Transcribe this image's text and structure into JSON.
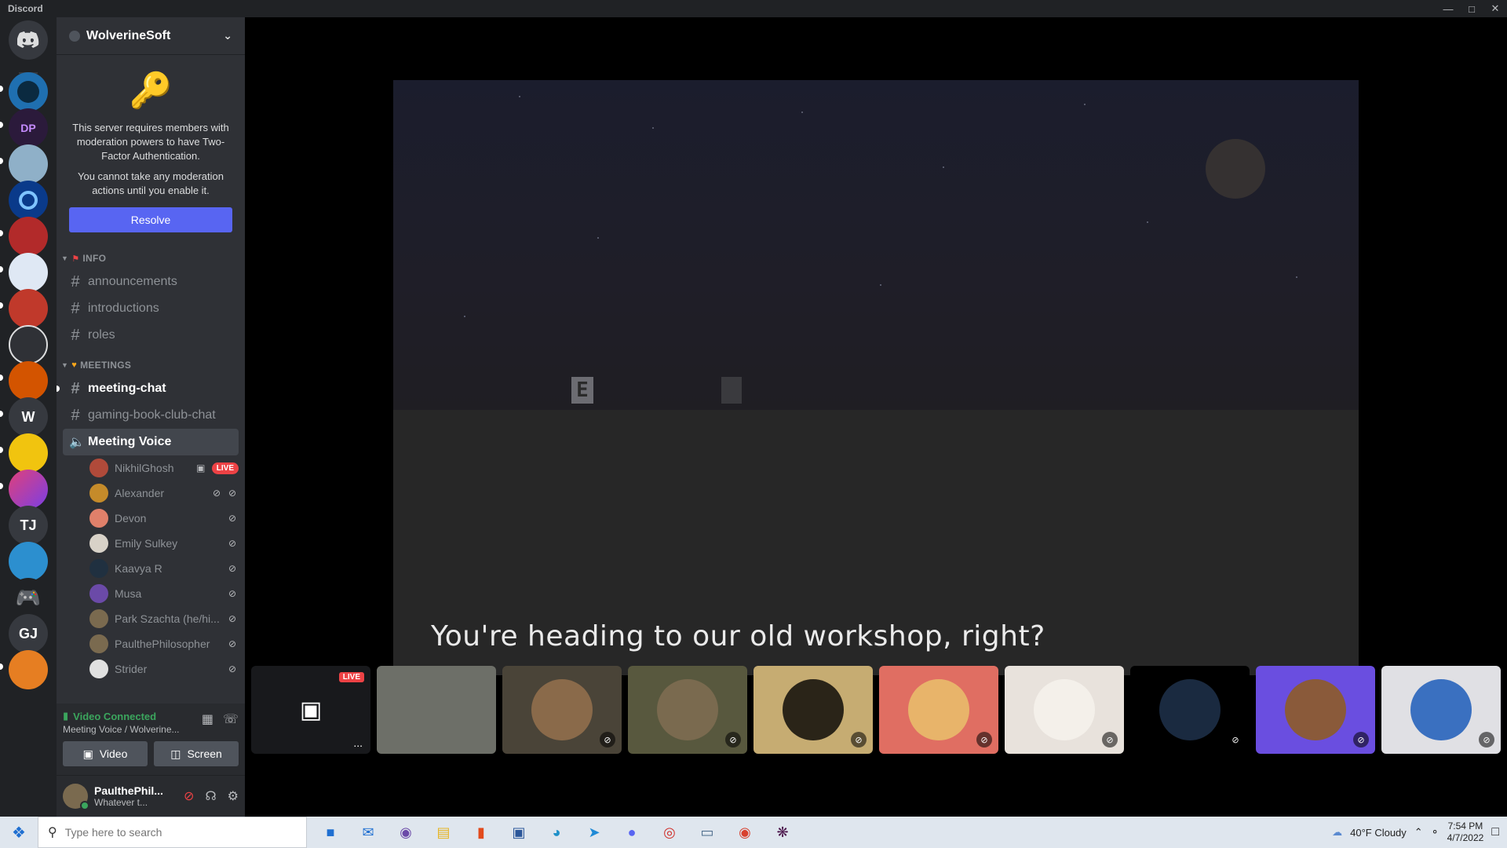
{
  "window": {
    "title": "Discord"
  },
  "server": {
    "name": "WolverineSoft",
    "twofa_message_1": "This server requires members with moderation powers to have Two-Factor Authentication.",
    "twofa_message_2": "You cannot take any moderation actions until you enable it.",
    "resolve_label": "Resolve"
  },
  "rail": {
    "home": "Discord",
    "letters": [
      "W",
      "TJ",
      "GJ"
    ]
  },
  "categories": {
    "info": "INFO",
    "meetings": "MEETINGS"
  },
  "channels": {
    "announcements": "announcements",
    "introductions": "introductions",
    "roles": "roles",
    "meeting_chat": "meeting-chat",
    "gaming_book_club": "gaming-book-club-chat",
    "meeting_voice": "Meeting Voice"
  },
  "voice_users": [
    {
      "name": "NikhilGhosh",
      "live": "LIVE",
      "color": "#b04a3a"
    },
    {
      "name": "Alexander",
      "color": "#c58b2a"
    },
    {
      "name": "Devon",
      "color": "#e0806a"
    },
    {
      "name": "Emily Sulkey",
      "color": "#d8d2c8"
    },
    {
      "name": "Kaavya R",
      "color": "#203040"
    },
    {
      "name": "Musa",
      "color": "#6b4aa8"
    },
    {
      "name": "Park Szachta (he/hi...",
      "color": "#7a6a4f"
    },
    {
      "name": "PaulthePhilosopher",
      "color": "#7a6a4f"
    },
    {
      "name": "Strider",
      "color": "#e0e0e0"
    }
  ],
  "voice_panel": {
    "status": "Video Connected",
    "subtitle": "Meeting Voice / Wolverine...",
    "video_label": "Video",
    "screen_label": "Screen"
  },
  "user_panel": {
    "username": "PaulthePhil...",
    "status": "Whatever t..."
  },
  "stream": {
    "subtitle": "You're heading to our old workshop, right?",
    "key_hint": "E"
  },
  "tiles": {
    "live": "LIVE",
    "more": "...",
    "colors": [
      "#18191c",
      "#6d6f68",
      "#4a4438",
      "#58583e",
      "#c6ac72",
      "#e06e62",
      "#e8e2dc",
      "#000000",
      "#6a4ee0",
      "#e0e0e4"
    ]
  },
  "taskbar": {
    "search_placeholder": "Type here to search",
    "weather": "40°F  Cloudy",
    "time": "7:54 PM",
    "date": "4/7/2022"
  },
  "colors": {
    "accent": "#5865f2",
    "live": "#ed4245",
    "connected": "#3ba55d"
  }
}
